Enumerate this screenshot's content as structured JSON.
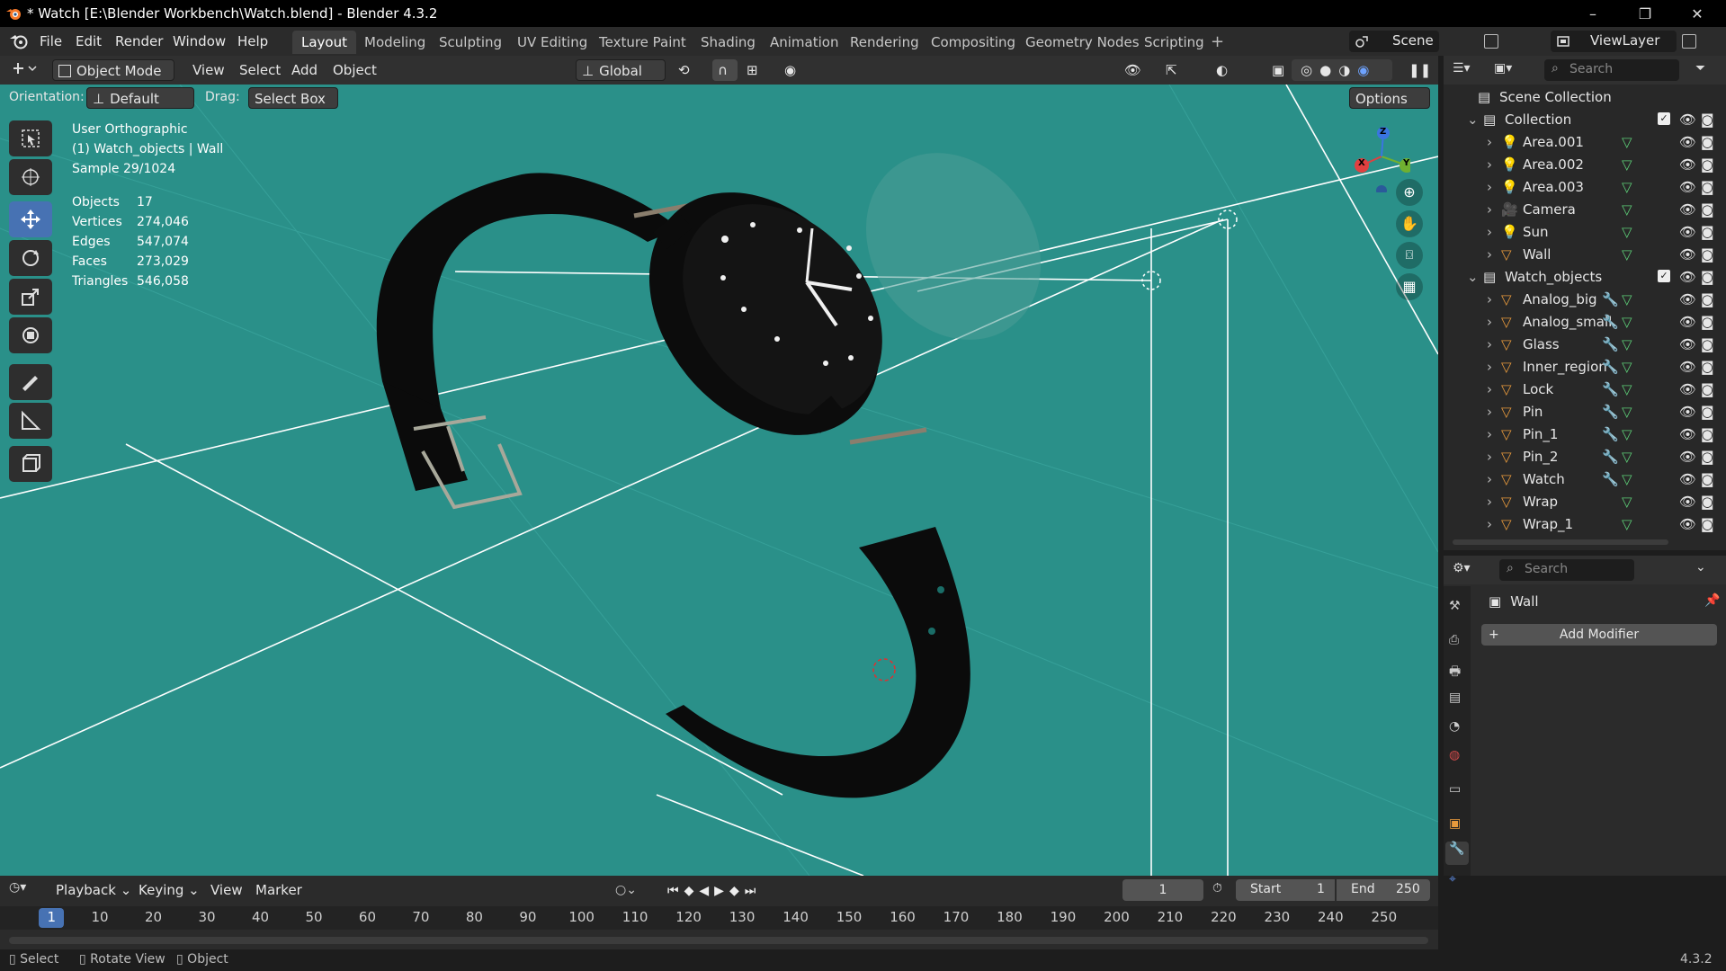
{
  "window": {
    "title": "* Watch [E:\\Blender Workbench\\Watch.blend] - Blender 4.3.2",
    "controls": [
      "–",
      "❐",
      "✕"
    ]
  },
  "menus": [
    "File",
    "Edit",
    "Render",
    "Window",
    "Help"
  ],
  "workspaces": [
    "Layout",
    "Modeling",
    "Sculpting",
    "UV Editing",
    "Texture Paint",
    "Shading",
    "Animation",
    "Rendering",
    "Compositing",
    "Geometry Nodes",
    "Scripting"
  ],
  "active_workspace": "Layout",
  "scene": "Scene",
  "view_layer": "ViewLayer",
  "viewport_header": {
    "mode": "Object Mode",
    "menus": [
      "View",
      "Select",
      "Add",
      "Object"
    ],
    "transform_orientation": "Global"
  },
  "tool_header": {
    "orientation_label": "Orientation:",
    "orientation_value": "Default",
    "drag_label": "Drag:",
    "drag_value": "Select Box",
    "options": "Options"
  },
  "overlay_text": {
    "view_name": "User Orthographic",
    "context": "(1) Watch_objects | Wall",
    "sample": "Sample 29/1024"
  },
  "stats": [
    {
      "label": "Objects",
      "value": "17"
    },
    {
      "label": "Vertices",
      "value": "274,046"
    },
    {
      "label": "Edges",
      "value": "547,074"
    },
    {
      "label": "Faces",
      "value": "273,029"
    },
    {
      "label": "Triangles",
      "value": "546,058"
    }
  ],
  "gizmo": {
    "x": "X",
    "y": "Y",
    "z": "Z"
  },
  "outliner": {
    "search_placeholder": "Search",
    "root": "Scene Collection",
    "collections": [
      {
        "name": "Collection",
        "objects": [
          "Area.001",
          "Area.002",
          "Area.003",
          "Camera",
          "Sun",
          "Wall"
        ]
      },
      {
        "name": "Watch_objects",
        "objects": [
          "Analog_big",
          "Analog_small",
          "Glass",
          "Inner_region",
          "Lock",
          "Pin",
          "Pin_1",
          "Pin_2",
          "Watch",
          "Wrap",
          "Wrap_1"
        ]
      }
    ]
  },
  "properties": {
    "search_placeholder": "Search",
    "object_name": "Wall",
    "add_modifier": "Add Modifier"
  },
  "timeline": {
    "menus": [
      "Playback",
      "Keying",
      "View",
      "Marker"
    ],
    "current_frame": "1",
    "start_label": "Start",
    "start": "1",
    "end_label": "End",
    "end": "250",
    "ticks": [
      "1",
      "10",
      "20",
      "30",
      "40",
      "50",
      "60",
      "70",
      "80",
      "90",
      "100",
      "110",
      "120",
      "130",
      "140",
      "150",
      "160",
      "170",
      "180",
      "190",
      "200",
      "210",
      "220",
      "230",
      "240",
      "250"
    ]
  },
  "statusbar": {
    "items": [
      "Select",
      "Rotate View",
      "Object"
    ],
    "version": "4.3.2"
  },
  "colors": {
    "viewport_bg": "#2a9089",
    "accent": "#4772b3",
    "mesh_icon": "#e89a3c",
    "light_icon": "#e89a3c",
    "modifier_icon": "#5d8ae0",
    "data_icon": "#5ccc76"
  }
}
